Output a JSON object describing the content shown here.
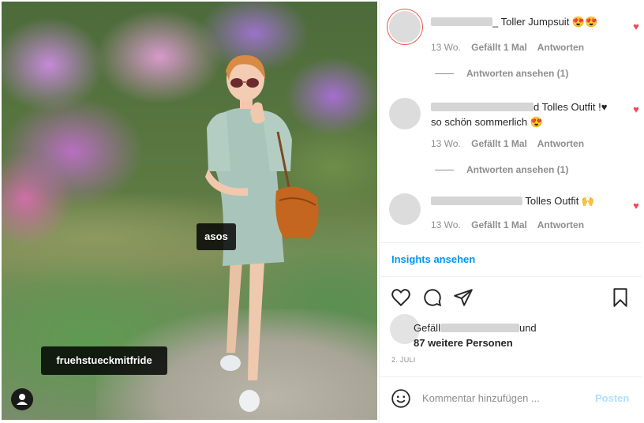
{
  "photo": {
    "tags": [
      {
        "label": "asos"
      },
      {
        "label": "fruehstueckmitfride"
      }
    ]
  },
  "comments": [
    {
      "text": "_ Toller Jumpsuit 😍😍",
      "time": "13 Wo.",
      "likes": "Gefällt 1 Mal",
      "reply": "Antworten",
      "view_replies": "Antworten ansehen (1)"
    },
    {
      "text": "d Tolles Outfit !♥ so schön sommerlich 😍",
      "time": "13 Wo.",
      "likes": "Gefällt 1 Mal",
      "reply": "Antworten",
      "view_replies": "Antworten ansehen (1)"
    },
    {
      "text": "Tolles Outfit 🙌",
      "time": "13 Wo.",
      "likes": "Gefällt 1 Mal",
      "reply": "Antworten"
    }
  ],
  "insights_label": "Insights ansehen",
  "likes": {
    "prefix": "Gefäll",
    "suffix": "und",
    "others": "87 weitere Personen"
  },
  "date": "2. JULI",
  "comment_input": {
    "placeholder": "Kommentar hinzufügen ...",
    "post_label": "Posten"
  },
  "colors": {
    "accent": "#0095f6",
    "heart": "#ed4956",
    "post_disabled": "#b2dffc"
  },
  "icons": [
    "like-icon",
    "comment-icon",
    "share-icon",
    "save-icon",
    "emoji-icon",
    "user-tag-icon"
  ]
}
